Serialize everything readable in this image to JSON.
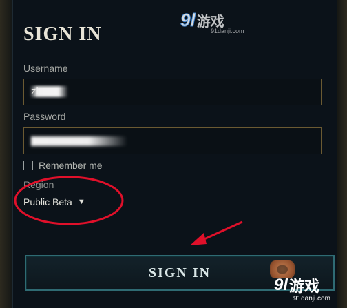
{
  "form": {
    "title": "SIGN IN",
    "username": {
      "label": "Username",
      "value": "zh"
    },
    "password": {
      "label": "Password",
      "value": ""
    },
    "remember_me": {
      "label": "Remember me",
      "checked": false
    },
    "region": {
      "label": "Region",
      "value": "Public Beta"
    },
    "submit_label": "SIGN IN"
  },
  "watermarks": {
    "top": {
      "logo": "9l",
      "text": "游戏",
      "domain": "91danji.com"
    },
    "bottom": {
      "logo": "9l",
      "text": "游戏",
      "domain": "91danji.com"
    }
  },
  "colors": {
    "background": "#0b1219",
    "input_border": "#6b5a32",
    "button_border": "#2f6b73",
    "annotation": "#e0102a"
  },
  "icons": {
    "region_dropdown": "triangle-down",
    "annotation_arrow": "arrow",
    "annotation_circle": "circle"
  }
}
